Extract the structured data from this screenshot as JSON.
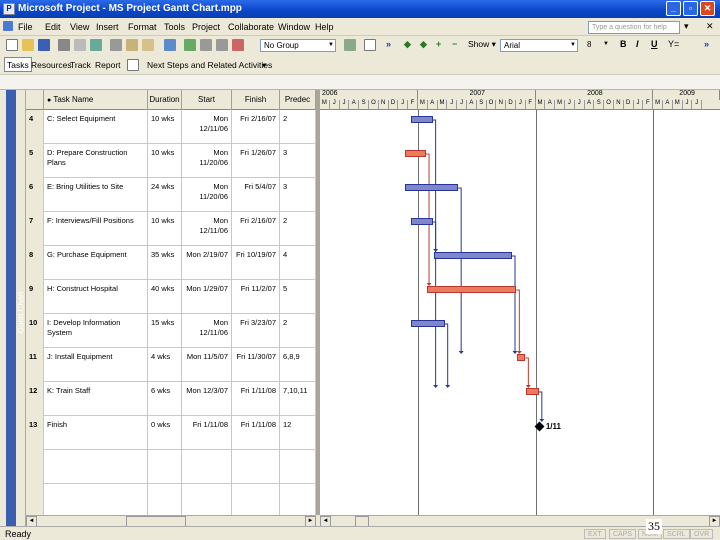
{
  "window": {
    "title": "Microsoft Project - MS Project Gantt Chart.mpp"
  },
  "menu": [
    "File",
    "Edit",
    "View",
    "Insert",
    "Format",
    "Tools",
    "Project",
    "Collaborate",
    "Window",
    "Help"
  ],
  "help_placeholder": "Type a question for help",
  "toolbar": {
    "group": "No Group",
    "show": "Show",
    "font": "Arial",
    "size": "8"
  },
  "taskbar_labels": {
    "tasks": "Tasks",
    "resources": "Resources",
    "track": "Track",
    "report": "Report",
    "next_steps": "Next Steps and Related Activities"
  },
  "view_label": "Gantt Chart",
  "table": {
    "headers": [
      "",
      "Task Name",
      "Duration",
      "Start",
      "Finish",
      "Predec"
    ],
    "rows": [
      {
        "id": "4",
        "name": "C: Select Equipment",
        "duration": "10 wks",
        "start": "Mon 12/11/06",
        "finish": "Fri 2/16/07",
        "pred": "2"
      },
      {
        "id": "5",
        "name": "D: Prepare Construction Plans",
        "duration": "10 wks",
        "start": "Mon 11/20/06",
        "finish": "Fri 1/26/07",
        "pred": "3"
      },
      {
        "id": "6",
        "name": "E: Bring Utilities to Site",
        "duration": "24 wks",
        "start": "Mon 11/20/06",
        "finish": "Fri 5/4/07",
        "pred": "3"
      },
      {
        "id": "7",
        "name": "F: Interviews/Fill Positions",
        "duration": "10 wks",
        "start": "Mon 12/11/06",
        "finish": "Fri 2/16/07",
        "pred": "2"
      },
      {
        "id": "8",
        "name": "G: Purchase Equipment",
        "duration": "35 wks",
        "start": "Mon 2/19/07",
        "finish": "Fri 10/19/07",
        "pred": "4"
      },
      {
        "id": "9",
        "name": "H: Construct Hospital",
        "duration": "40 wks",
        "start": "Mon 1/29/07",
        "finish": "Fri 11/2/07",
        "pred": "5"
      },
      {
        "id": "10",
        "name": "I: Develop Information System",
        "duration": "15 wks",
        "start": "Mon 12/11/06",
        "finish": "Fri 3/23/07",
        "pred": "2"
      },
      {
        "id": "11",
        "name": "J: Install Equipment",
        "duration": "4 wks",
        "start": "Mon 11/5/07",
        "finish": "Fri 11/30/07",
        "pred": "6,8,9"
      },
      {
        "id": "12",
        "name": "K: Train Staff",
        "duration": "6 wks",
        "start": "Mon 12/3/07",
        "finish": "Fri 1/11/08",
        "pred": "7,10,11"
      },
      {
        "id": "13",
        "name": "Finish",
        "duration": "0 wks",
        "start": "Fri 1/11/08",
        "finish": "Fri 1/11/08",
        "pred": "12"
      }
    ]
  },
  "timeline": {
    "years": [
      "2006",
      "2007",
      "2008",
      "2009"
    ],
    "months": [
      "M",
      "J",
      "J",
      "A",
      "S",
      "O",
      "N",
      "D",
      "J",
      "F",
      "M",
      "A",
      "M",
      "J",
      "J",
      "A",
      "S",
      "O",
      "N",
      "D",
      "J",
      "F",
      "M",
      "A",
      "M",
      "J",
      "J",
      "A",
      "S",
      "O",
      "N",
      "D",
      "J",
      "F",
      "M",
      "A",
      "M",
      "J",
      "J"
    ],
    "milestone_label": "1/11"
  },
  "status": {
    "ready": "Ready",
    "indicators": [
      "EXT",
      "CAPS",
      "NUM",
      "SCRL",
      "OVR"
    ]
  },
  "slide_number": "35"
}
